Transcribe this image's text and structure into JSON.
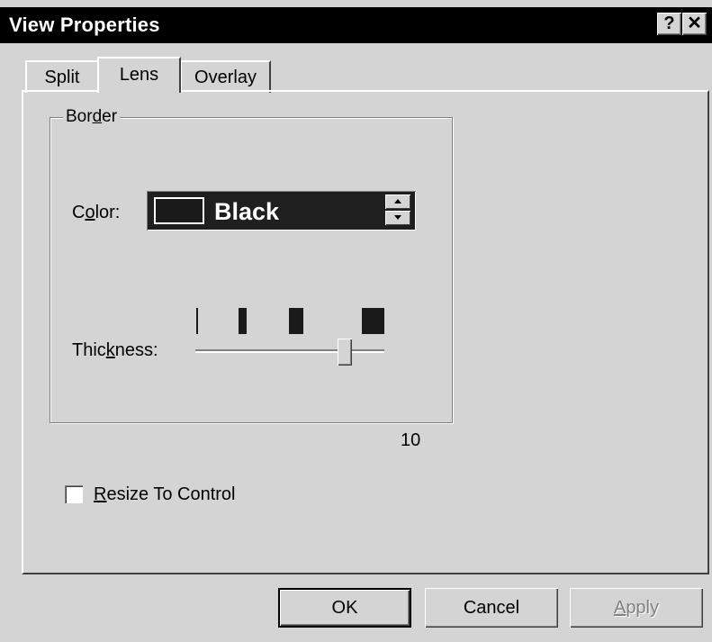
{
  "window": {
    "title": "View Properties",
    "help_glyph": "?",
    "close_glyph": "✕"
  },
  "tabs": [
    {
      "label": "Split",
      "active": false
    },
    {
      "label": "Lens",
      "active": true
    },
    {
      "label": "Overlay",
      "active": false
    }
  ],
  "border_group": {
    "label_prefix": "Bor",
    "label_mnemonic": "d",
    "label_suffix": "er",
    "color": {
      "label_prefix": "C",
      "label_mnemonic": "o",
      "label_suffix": "lor:",
      "value": "Black",
      "swatch_color": "#1a1a1a"
    },
    "thickness": {
      "label_prefix": "Thic",
      "label_mnemonic": "k",
      "label_suffix": "ness:",
      "value": "10",
      "slider_fraction": 0.76
    }
  },
  "resize_to_control": {
    "label_mnemonic": "R",
    "label_suffix": "esize To Control",
    "checked": false
  },
  "buttons": {
    "ok": "OK",
    "cancel": "Cancel",
    "apply_mnemonic": "A",
    "apply_suffix": "pply"
  },
  "icons": [
    "help-icon",
    "close-icon",
    "spin-up-icon",
    "spin-down-icon"
  ]
}
